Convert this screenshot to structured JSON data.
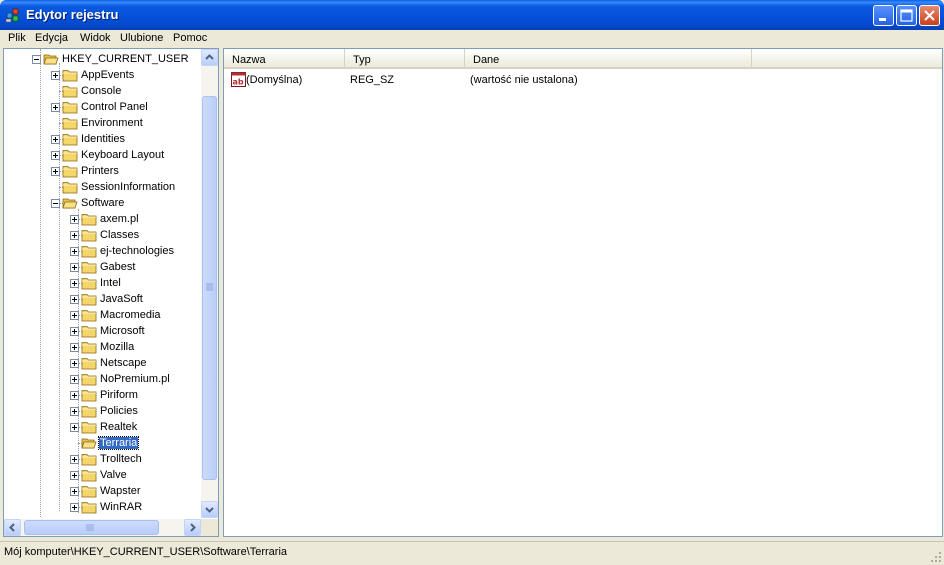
{
  "window": {
    "title": "Edytor rejestru",
    "icon": "regedit-icon",
    "controls": [
      "minimize-icon",
      "maximize-icon",
      "close-icon"
    ]
  },
  "menu": {
    "items": [
      "Plik",
      "Edycja",
      "Widok",
      "Ulubione",
      "Pomoc"
    ]
  },
  "tree": {
    "root": "HKEY_CURRENT_USER",
    "children": [
      {
        "label": "AppEvents",
        "expandable": true
      },
      {
        "label": "Console",
        "expandable": false
      },
      {
        "label": "Control Panel",
        "expandable": true
      },
      {
        "label": "Environment",
        "expandable": false
      },
      {
        "label": "Identities",
        "expandable": true
      },
      {
        "label": "Keyboard Layout",
        "expandable": true
      },
      {
        "label": "Printers",
        "expandable": true
      },
      {
        "label": "SessionInformation",
        "expandable": false
      },
      {
        "label": "Software",
        "expandable": true,
        "expanded": true
      }
    ],
    "software_children": [
      {
        "label": "axem.pl",
        "expandable": true
      },
      {
        "label": "Classes",
        "expandable": true
      },
      {
        "label": "ej-technologies",
        "expandable": true
      },
      {
        "label": "Gabest",
        "expandable": true
      },
      {
        "label": "Intel",
        "expandable": true
      },
      {
        "label": "JavaSoft",
        "expandable": true
      },
      {
        "label": "Macromedia",
        "expandable": true
      },
      {
        "label": "Microsoft",
        "expandable": true
      },
      {
        "label": "Mozilla",
        "expandable": true
      },
      {
        "label": "Netscape",
        "expandable": true
      },
      {
        "label": "NoPremium.pl",
        "expandable": true
      },
      {
        "label": "Piriform",
        "expandable": true
      },
      {
        "label": "Policies",
        "expandable": true
      },
      {
        "label": "Realtek",
        "expandable": true
      },
      {
        "label": "Terraria",
        "expandable": false,
        "selected": true
      },
      {
        "label": "Trolltech",
        "expandable": true
      },
      {
        "label": "Valve",
        "expandable": true
      },
      {
        "label": "Wapster",
        "expandable": true
      },
      {
        "label": "WinRAR",
        "expandable": true
      }
    ]
  },
  "list": {
    "columns": [
      "Nazwa",
      "Typ",
      "Dane"
    ],
    "rows": [
      {
        "name": "(Domyślna)",
        "type": "REG_SZ",
        "data": "(wartość nie ustalona)",
        "icon": "string-value-icon"
      }
    ]
  },
  "statusbar": {
    "path": "Mój komputer\\HKEY_CURRENT_USER\\Software\\Terraria"
  },
  "colors": {
    "titlebar": "#0450d8",
    "selection": "#316ac5",
    "folder": "#f6d66b"
  }
}
